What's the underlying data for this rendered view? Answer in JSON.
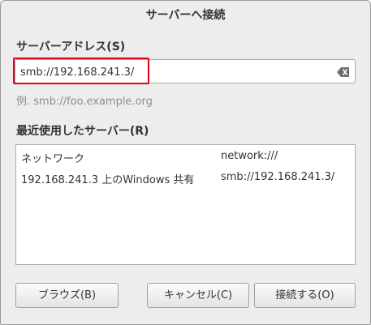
{
  "dialog": {
    "title": "サーバーへ接続"
  },
  "address": {
    "label": "サーバーアドレス(S)",
    "value": "smb://192.168.241.3/",
    "clear_icon": "clear-text-icon",
    "example": "例.  smb://foo.example.org"
  },
  "recent": {
    "label": "最近使用したサーバー(R)",
    "servers": [
      {
        "name": "ネットワーク",
        "uri": "network:///"
      },
      {
        "name": "192.168.241.3 上のWindows 共有",
        "uri": "smb://192.168.241.3/"
      }
    ]
  },
  "buttons": {
    "browse": "ブラウズ(B)",
    "cancel": "キャンセル(C)",
    "connect": "接続する(O)"
  },
  "colors": {
    "highlight": "#e0001a"
  }
}
